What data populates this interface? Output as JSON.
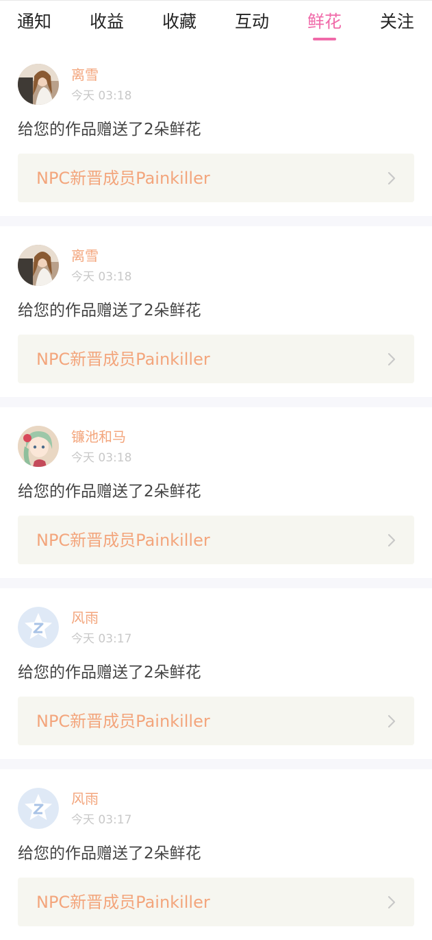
{
  "tabs": [
    {
      "label": "通知",
      "active": false
    },
    {
      "label": "收益",
      "active": false
    },
    {
      "label": "收藏",
      "active": false
    },
    {
      "label": "互动",
      "active": false
    },
    {
      "label": "鲜花",
      "active": true
    },
    {
      "label": "关注",
      "active": false
    }
  ],
  "colors": {
    "accent_pink": "#f06aa9",
    "name_orange": "#f3a57c",
    "card_bg": "#f6f6f0",
    "separator": "#f7f7fb"
  },
  "notifications": [
    {
      "user": "离雪",
      "time": "今天 03:18",
      "message": "给您的作品赠送了2朵鲜花",
      "work": "NPC新晋成员Painkiller",
      "avatar": "photo-avatar"
    },
    {
      "user": "离雪",
      "time": "今天 03:18",
      "message": "给您的作品赠送了2朵鲜花",
      "work": "NPC新晋成员Painkiller",
      "avatar": "photo-avatar"
    },
    {
      "user": "镰池和马",
      "time": "今天 03:18",
      "message": "给您的作品赠送了2朵鲜花",
      "work": "NPC新晋成员Painkiller",
      "avatar": "anime-avatar"
    },
    {
      "user": "风雨",
      "time": "今天 03:17",
      "message": "给您的作品赠送了2朵鲜花",
      "work": "NPC新晋成员Painkiller",
      "avatar": "default-qzone-avatar"
    },
    {
      "user": "风雨",
      "time": "今天 03:17",
      "message": "给您的作品赠送了2朵鲜花",
      "work": "NPC新晋成员Painkiller",
      "avatar": "default-qzone-avatar"
    }
  ]
}
